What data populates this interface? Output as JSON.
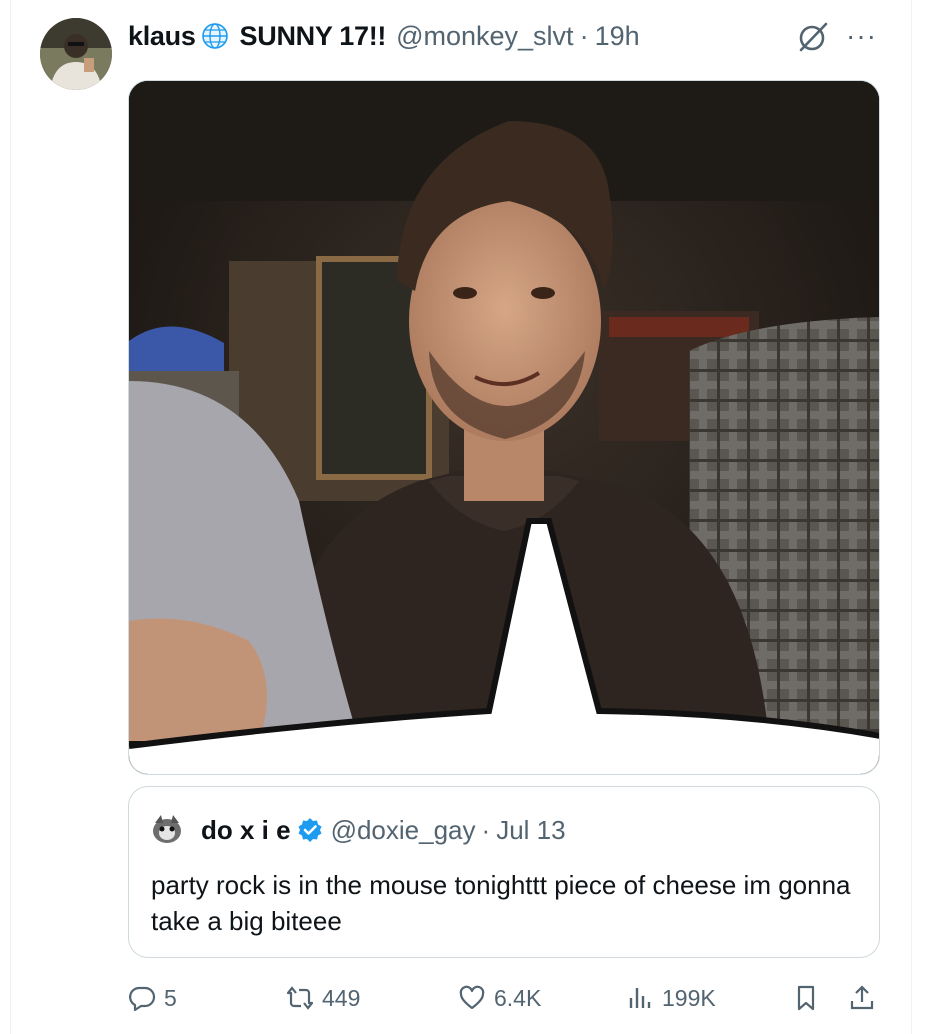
{
  "tweet": {
    "author_name": "klaus",
    "author_suffix": "SUNNY 17!!",
    "handle": "@monkey_slvt",
    "separator": "·",
    "time": "19h",
    "more_label": "···"
  },
  "quoted": {
    "author_name": "do x i e",
    "handle": "@doxie_gay",
    "separator": "·",
    "date": "Jul 13",
    "text": "party rock is in the mouse tonighttt piece of cheese im gonna take a big biteee"
  },
  "actions": {
    "replies": "5",
    "reposts": "449",
    "likes": "6.4K",
    "views": "199K"
  },
  "icons": {
    "reply": "reply-icon",
    "repost": "repost-icon",
    "like": "heart-icon",
    "views": "analytics-icon",
    "bookmark": "bookmark-icon",
    "share": "share-icon",
    "grok": "grok-icon",
    "globe": "globe-icon",
    "verified": "verified-badge-icon"
  },
  "colors": {
    "text": "#0f1419",
    "secondary": "#536471",
    "border": "#cfd9de",
    "verified": "#1d9bf0"
  }
}
